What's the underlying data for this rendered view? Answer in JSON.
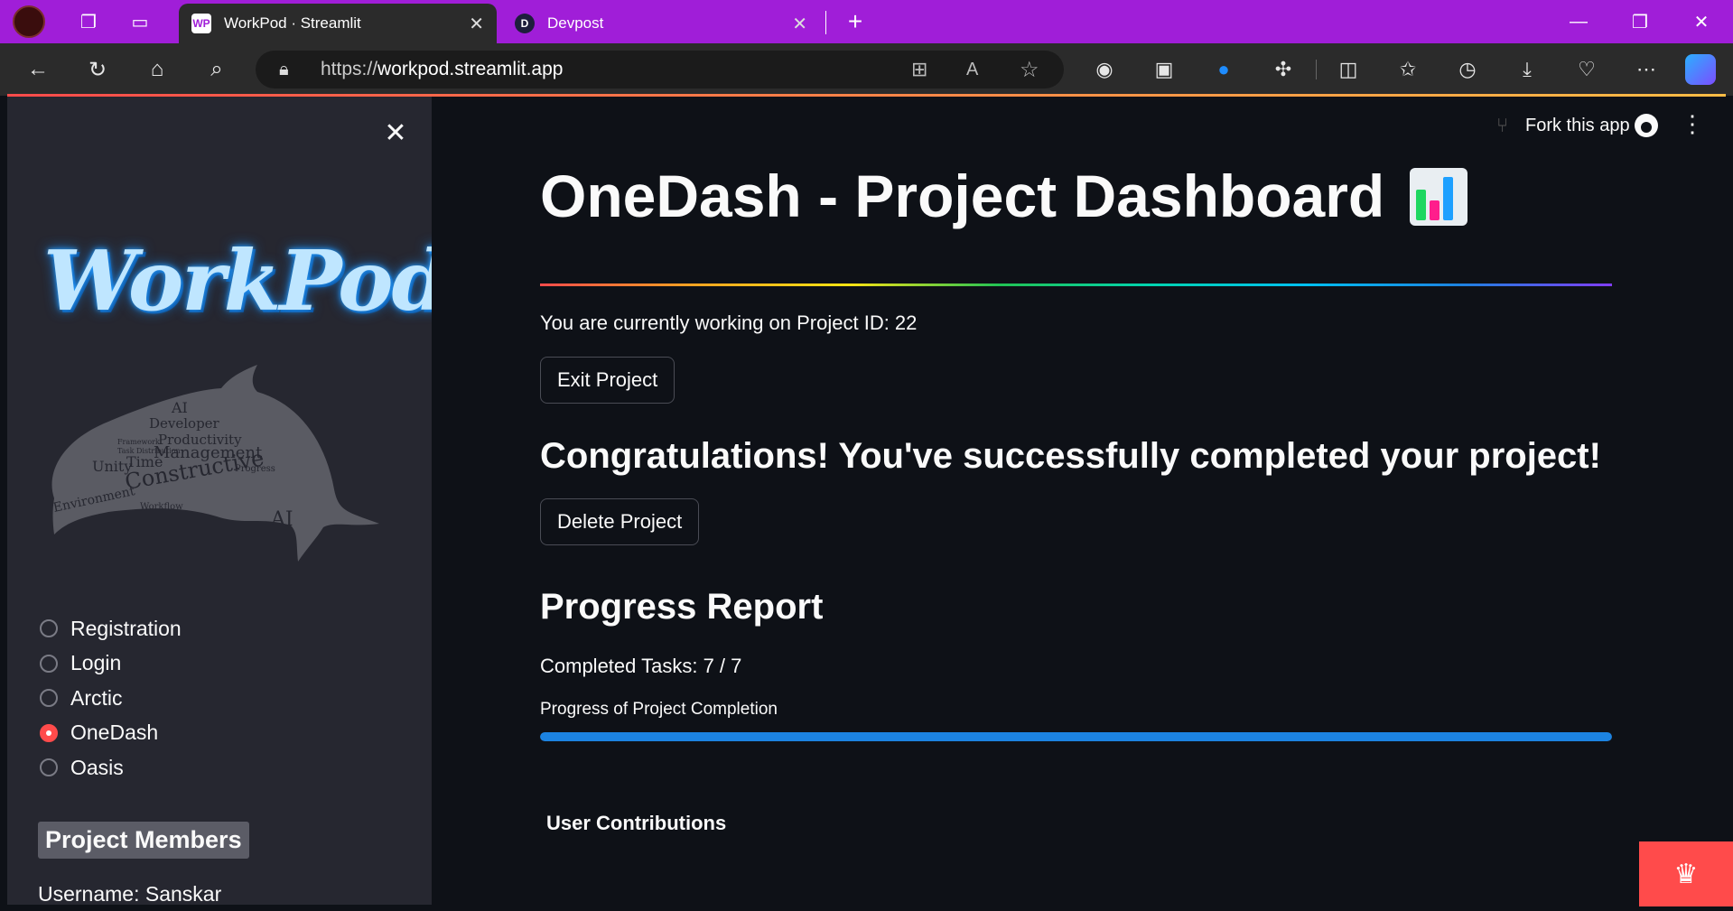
{
  "browser": {
    "tabs": [
      {
        "title": "WorkPod · Streamlit",
        "favicon": "WP",
        "active": true
      },
      {
        "title": "Devpost",
        "favicon": "D",
        "active": false
      }
    ],
    "url_prefix": "https://",
    "url_domain": "workpod.streamlit.app",
    "icons": {
      "profile": "profile-avatar-icon",
      "workspaces": "workspaces-icon",
      "tab-actions": "tab-actions-icon",
      "back": "back-arrow-icon",
      "refresh": "refresh-icon",
      "home": "home-icon",
      "search": "search-icon",
      "lock": "lock-icon",
      "apps": "apps-icon",
      "read-aloud": "read-aloud-icon",
      "favorite": "star-icon",
      "copilot": "copilot-icon"
    }
  },
  "sidebar": {
    "logo_text": "WorkPod",
    "word_cloud": [
      "AI",
      "Developer",
      "Productivity",
      "Time",
      "Management",
      "Unity",
      "Constructive",
      "Environment",
      "Workflow",
      "Progress",
      "Framework",
      "Task Distribution"
    ],
    "nav_options": [
      {
        "label": "Registration",
        "selected": false
      },
      {
        "label": "Login",
        "selected": false
      },
      {
        "label": "Arctic",
        "selected": false
      },
      {
        "label": "OneDash",
        "selected": true
      },
      {
        "label": "Oasis",
        "selected": false
      }
    ],
    "members_heading": "Project Members",
    "username_line": "Username: Sanskar"
  },
  "header": {
    "fork_label": "Fork this app"
  },
  "main": {
    "title": "OneDash - Project Dashboard",
    "project_info": "You are currently working on Project ID: 22",
    "exit_button": "Exit Project",
    "congrats": "Congratulations! You've successfully completed your project!",
    "delete_button": "Delete Project",
    "progress_heading": "Progress Report",
    "completed_tasks": "Completed Tasks: 7 / 7",
    "progress_label": "Progress of Project Completion",
    "progress_value": 1.0,
    "contributions_heading": "User Contributions"
  },
  "colors": {
    "tabbar": "#a01ed8",
    "accent": "#ff4b4b",
    "progress": "#1c83e1",
    "background": "#0e1117",
    "sidebar": "#262730"
  }
}
